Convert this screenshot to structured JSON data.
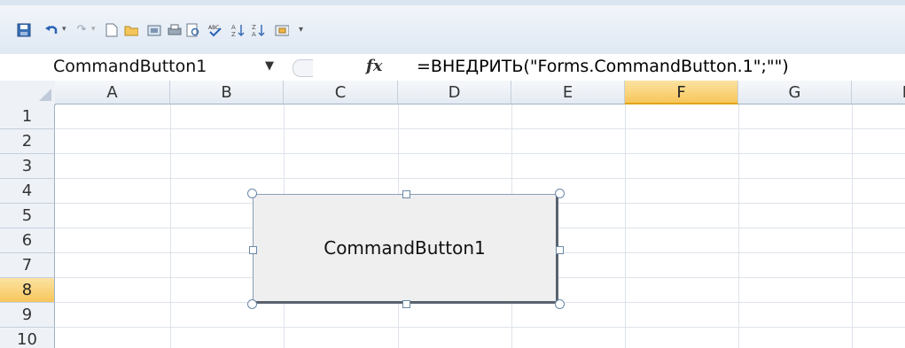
{
  "quick_access_toolbar": {
    "icons": [
      "save-icon",
      "undo-icon",
      "undo-dropdown-icon",
      "redo-icon",
      "redo-dropdown-icon",
      "new-document-icon",
      "open-folder-icon",
      "export-icon",
      "print-icon",
      "print-preview-icon",
      "spelling-icon",
      "sort-ascending-icon",
      "sort-descending-icon",
      "design-mode-icon",
      "customize-toolbar-icon"
    ]
  },
  "formula_bar": {
    "name_box": "CommandButton1",
    "fx_label": "fx",
    "formula": "=ВНЕДРИТЬ(\"Forms.CommandButton.1\";\"\")"
  },
  "grid": {
    "columns": [
      "A",
      "B",
      "C",
      "D",
      "E",
      "F",
      "G",
      "H"
    ],
    "selected_column": "F",
    "rows": [
      "1",
      "2",
      "3",
      "4",
      "5",
      "6",
      "7",
      "8",
      "9",
      "10"
    ],
    "selected_row": "8"
  },
  "command_button": {
    "label": "CommandButton1"
  },
  "colors": {
    "selected_header": "#f8c65b",
    "toolbar_bg": "#dfe8f3",
    "grid_line": "#dde3ea"
  }
}
